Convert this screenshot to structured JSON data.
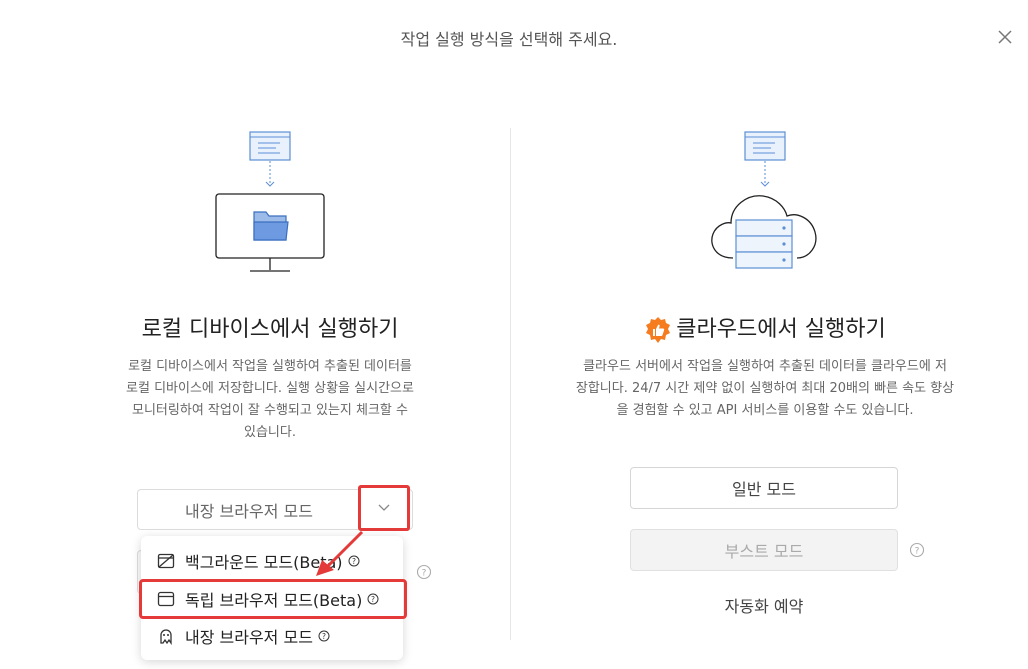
{
  "dialog": {
    "title": "작업 실행 방식을 선택해 주세요."
  },
  "local": {
    "title": "로컬 디바이스에서 실행하기",
    "description_lines": [
      "로컬 디바이스에서 작업을 실행하여 추출된 데이터를",
      "로컬 디바이스에 저장합니다. 실행 상황을 실시간으로",
      "모니터링하여 작업이 잘 수행되고 있는지 체크할 수",
      "있습니다."
    ],
    "mode_button_label": "내장 브라우저 모드",
    "dropdown": [
      {
        "label": "백그라운드 모드(Beta)",
        "icon": "background-mode-icon"
      },
      {
        "label": "독립 브라우저 모드(Beta)",
        "icon": "browser-window-icon"
      },
      {
        "label": "내장 브라우저 모드",
        "icon": "robot-icon"
      }
    ]
  },
  "cloud": {
    "title": "클라우드에서 실행하기",
    "description_lines": [
      "클라우드 서버에서 작업을 실행하여 추출된 데이터를 클라우드에 저",
      "장합니다. 24/7 시간 제약 없이 실행하여 최대 20배의 빠른 속도 향상",
      "을 경험할 수 있고 API 서비스를 이용할 수도 있습니다."
    ],
    "normal_mode_label": "일반 모드",
    "boost_mode_label": "부스트 모드",
    "schedule_label": "자동화 예약"
  },
  "colors": {
    "highlight": "#e43a3a",
    "accent_orange": "#f57c1f",
    "illustration_blue": "#5b8fd6"
  }
}
